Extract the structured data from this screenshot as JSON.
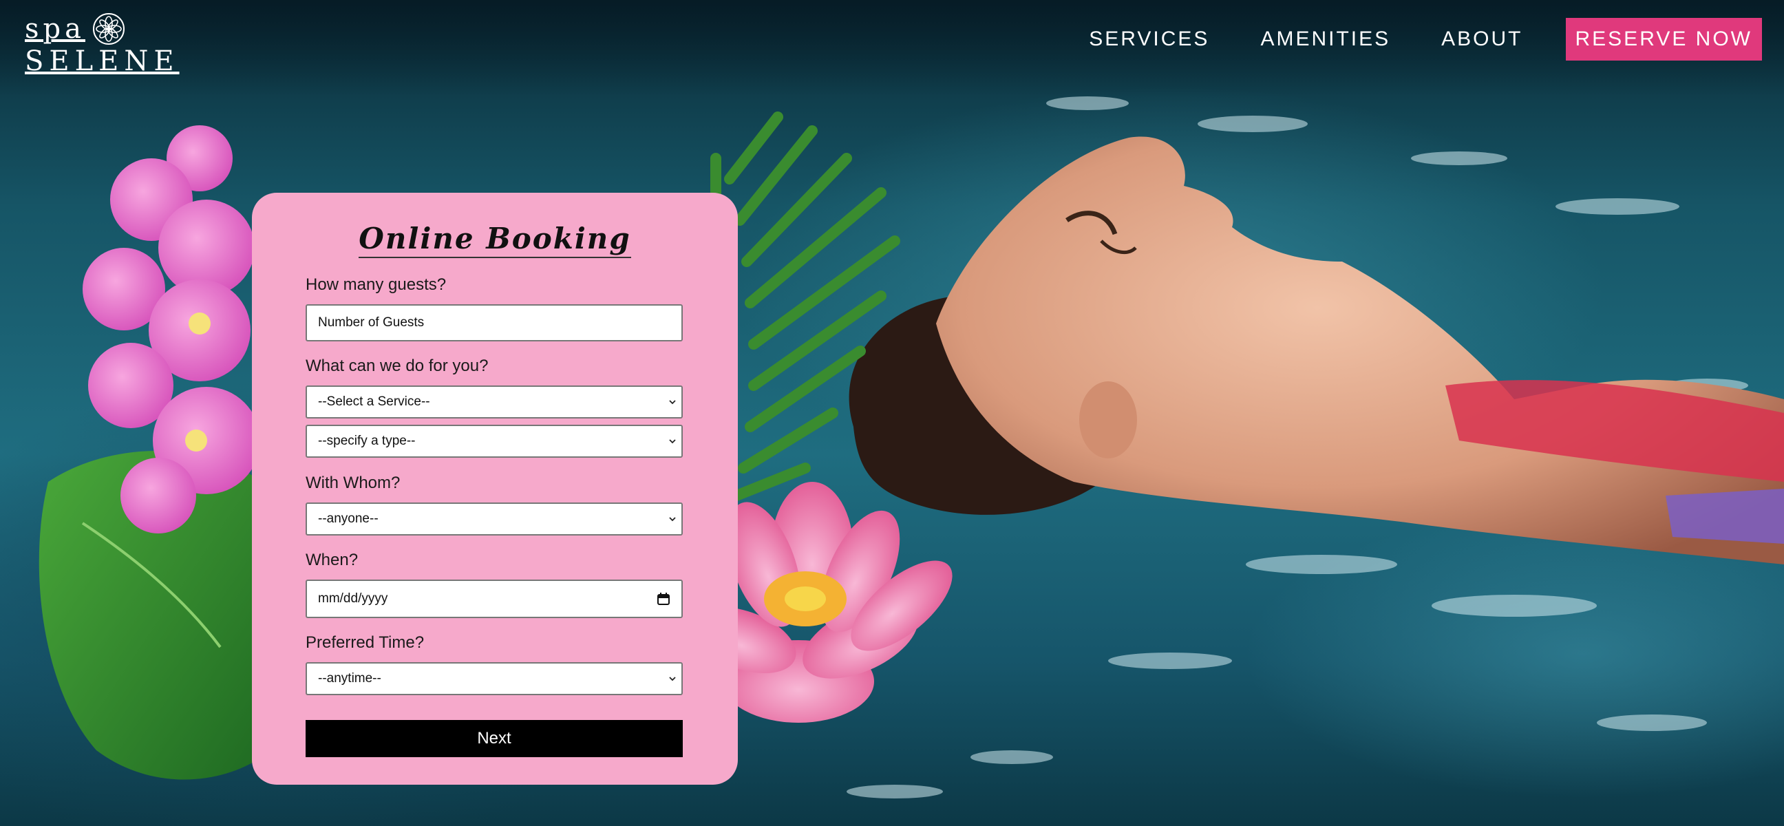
{
  "brand": {
    "line1": "spa",
    "line2": "SELENE"
  },
  "nav": {
    "items": [
      "SERVICES",
      "AMENITIES",
      "ABOUT"
    ],
    "cta": "RESERVE NOW",
    "accent": "#e0397c"
  },
  "booking": {
    "title": "Online Booking",
    "card_color": "#f6a9cb",
    "guests_label": "How many guests?",
    "guests_placeholder": "Number of Guests",
    "service_label": "What can we do for you?",
    "service_select": "--Select a Service--",
    "type_select": "--specify a type--",
    "whom_label": "With Whom?",
    "whom_select": "--anyone--",
    "when_label": "When?",
    "date_placeholder": "mm/dd/yyyy",
    "time_label": "Preferred Time?",
    "time_select": "--anytime--",
    "next_label": "Next"
  },
  "icons": [
    "lotus-logo-icon",
    "chevron-down-icon",
    "calendar-icon"
  ]
}
